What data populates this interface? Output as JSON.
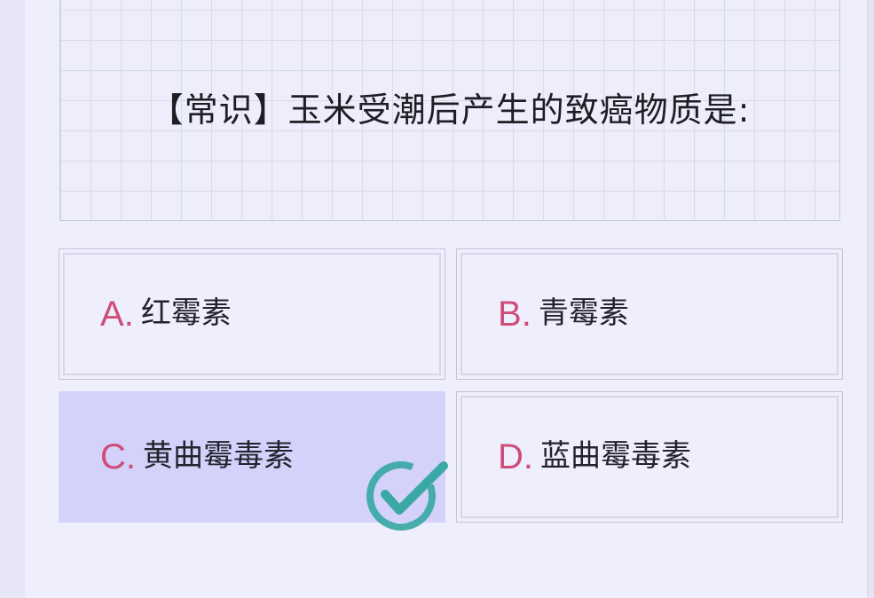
{
  "quiz": {
    "question": "【常识】玉米受潮后产生的致癌物质是:",
    "options": [
      {
        "letter": "A",
        "text": "红霉素",
        "selected": false
      },
      {
        "letter": "B",
        "text": "青霉素",
        "selected": false
      },
      {
        "letter": "C",
        "text": "黄曲霉毒素",
        "selected": true
      },
      {
        "letter": "D",
        "text": "蓝曲霉毒素",
        "selected": false
      }
    ],
    "answer_indicator": "check-icon"
  },
  "colors": {
    "letter": "#cf4d78",
    "selected_bg": "#d4d1fb",
    "check": "#3aa8a4"
  }
}
